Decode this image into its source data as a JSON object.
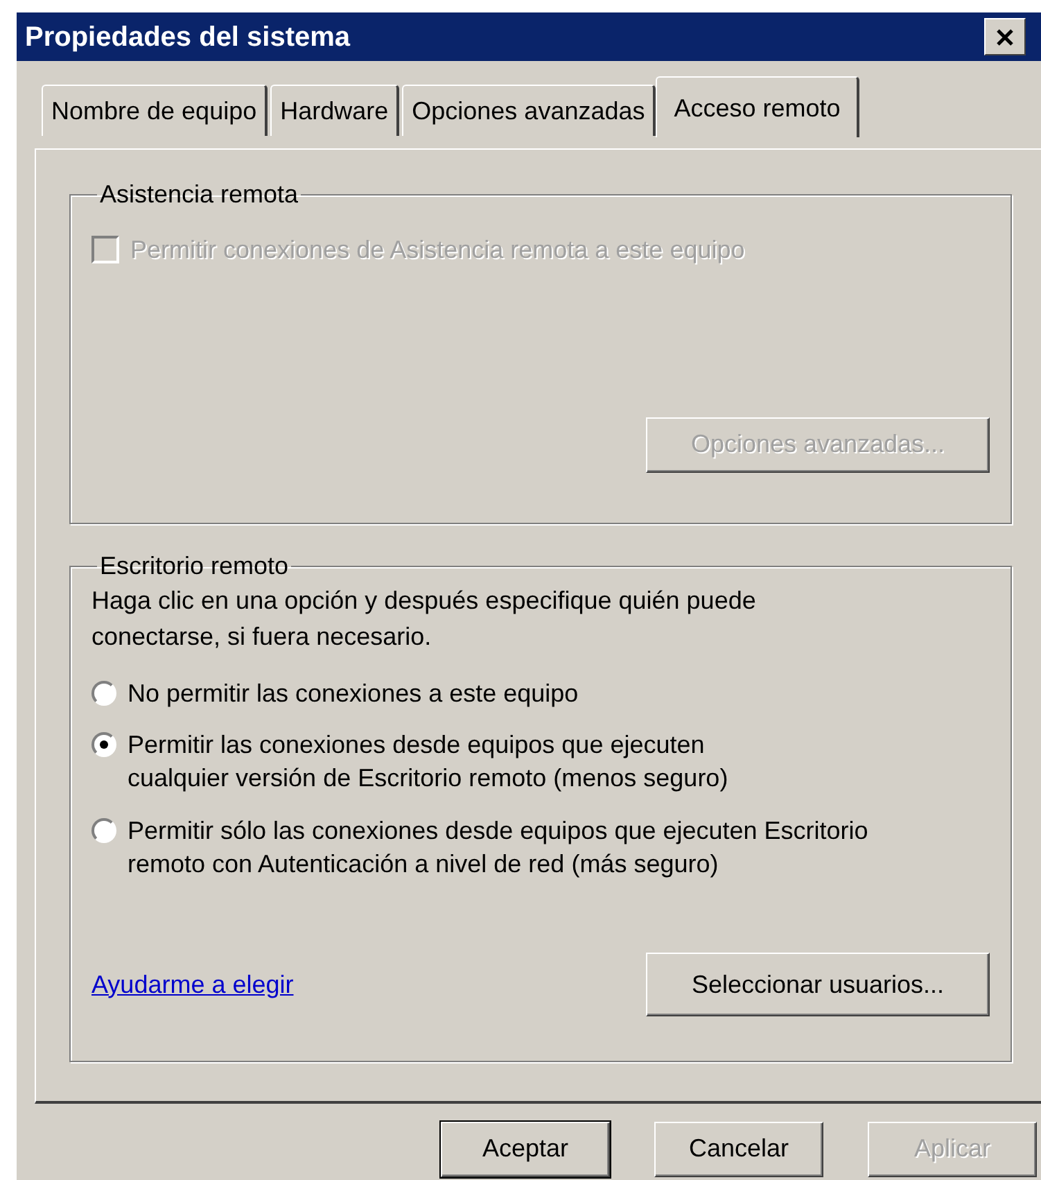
{
  "window": {
    "title": "Propiedades del sistema"
  },
  "tabs": [
    {
      "label": "Nombre de equipo",
      "selected": false
    },
    {
      "label": "Hardware",
      "selected": false
    },
    {
      "label": "Opciones avanzadas",
      "selected": false
    },
    {
      "label": "Acceso remoto",
      "selected": true
    }
  ],
  "remote_assistance": {
    "title": "Asistencia remota",
    "checkbox": {
      "label": "Permitir conexiones de Asistencia remota a este equipo",
      "checked": false,
      "disabled": true
    },
    "button": {
      "label": "Opciones avanzadas...",
      "disabled": true
    }
  },
  "remote_desktop": {
    "title": "Escritorio remoto",
    "description": "Haga clic en una opción y después especifique quién puede\nconectarse, si fuera necesario.",
    "options": [
      {
        "label": "No permitir las conexiones a este equipo",
        "selected": false
      },
      {
        "label": "Permitir las conexiones desde equipos que ejecuten\ncualquier versión de Escritorio remoto (menos seguro)",
        "selected": true
      },
      {
        "label": "Permitir sólo las conexiones desde equipos que ejecuten Escritorio\nremoto con Autenticación a nivel de red (más seguro)",
        "selected": false
      }
    ],
    "help_link": "Ayudarme a elegir",
    "button": {
      "label": "Seleccionar usuarios...",
      "disabled": false
    }
  },
  "buttons": [
    {
      "label": "Aceptar",
      "default": true,
      "disabled": false
    },
    {
      "label": "Cancelar",
      "default": false,
      "disabled": false
    },
    {
      "label": "Aplicar",
      "default": false,
      "disabled": true
    }
  ]
}
